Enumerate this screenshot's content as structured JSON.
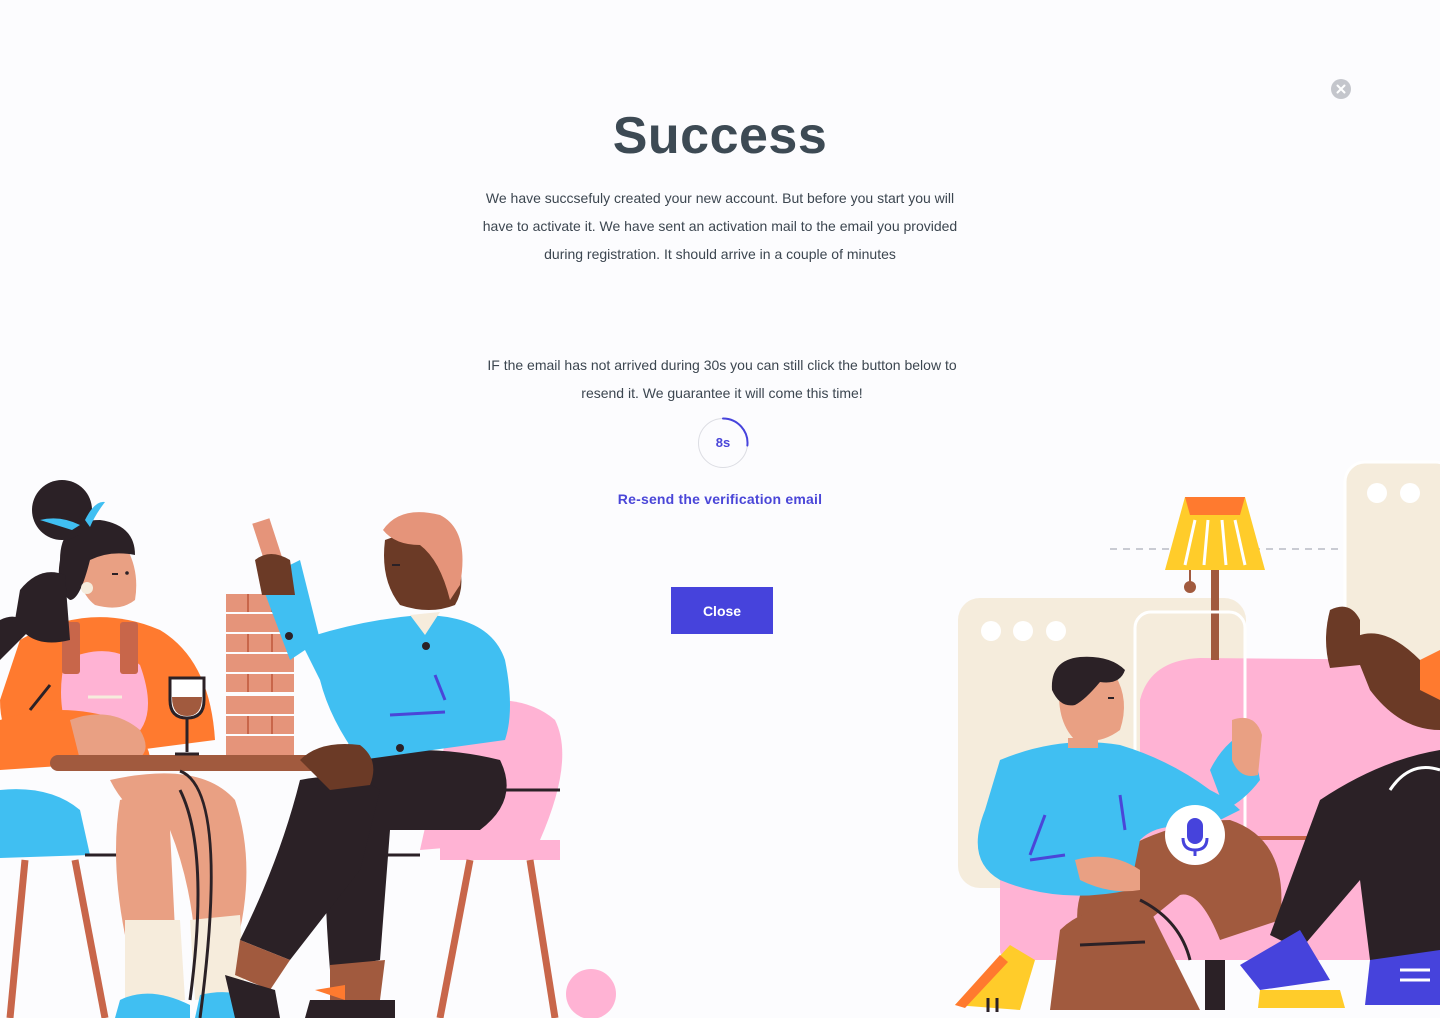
{
  "dialog": {
    "title": "Success",
    "description": "We have succsefuly created your new account. But before you start you will have to activate it. We have sent an activation mail to the email you provided during registration. It should arrive in a couple of minutes",
    "resend_info": "IF the email has not arrived during 30s you can still click the button below to resend it. We guarantee it will come this time!",
    "timer": {
      "label": "8s",
      "remaining_seconds": 8,
      "total_seconds": 30
    },
    "resend_link": "Re-send the verification email",
    "close_button": "Close",
    "dismiss_icon": "close-icon"
  },
  "colors": {
    "accent": "#4643dc",
    "title": "#3d4a54",
    "text": "#3c4650",
    "background": "#fcfcfe"
  }
}
